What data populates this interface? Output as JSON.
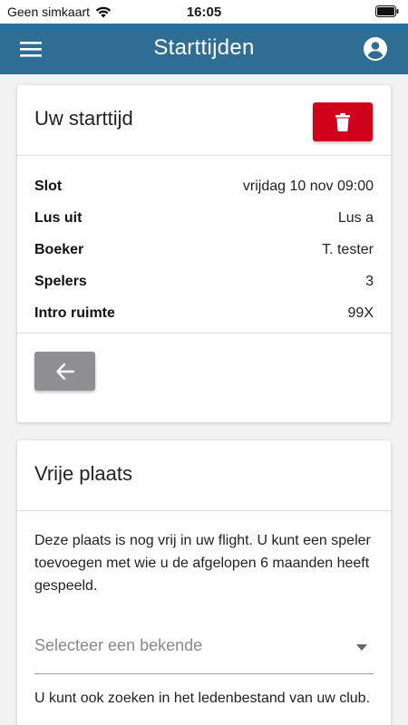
{
  "status_bar": {
    "carrier": "Geen simkaart",
    "time": "16:05"
  },
  "app_bar": {
    "title": "Starttijden",
    "color": "#2f6d94"
  },
  "start_time_card": {
    "title": "Uw starttijd",
    "rows": [
      {
        "label": "Slot",
        "value": "vrijdag 10 nov 09:00"
      },
      {
        "label": "Lus uit",
        "value": "Lus a"
      },
      {
        "label": "Boeker",
        "value": "T. tester"
      },
      {
        "label": "Spelers",
        "value": "3"
      },
      {
        "label": "Intro ruimte",
        "value": "99X"
      }
    ],
    "delete_color": "#d0021b",
    "back_color": "#8e8e93"
  },
  "free_spot_card": {
    "title": "Vrije plaats",
    "description": "Deze plaats is nog vrij in uw flight. U kunt een speler toevoegen met wie u de afgelopen 6 maanden heeft gespeeld.",
    "select_placeholder": "Selecteer een bekende",
    "search_hint": "U kunt ook zoeken in het ledenbestand van uw club."
  },
  "icons": {
    "menu": "menu-icon",
    "account": "account-circle-icon",
    "delete": "trash-icon",
    "back": "arrow-left-icon",
    "dropdown": "caret-down-icon",
    "wifi": "wifi-icon",
    "battery": "battery-icon"
  }
}
